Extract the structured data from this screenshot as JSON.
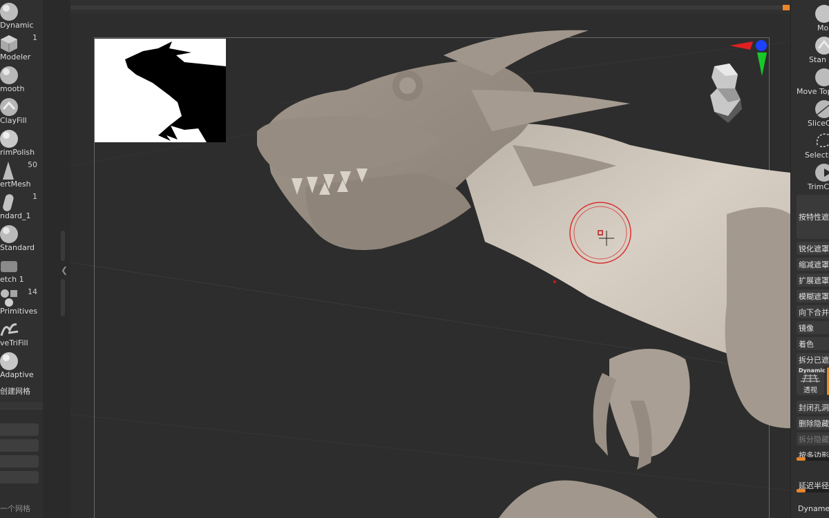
{
  "left_shelf": {
    "brushes": [
      {
        "label": "Dynamic",
        "icon": "dynamic-sphere-icon",
        "count": ""
      },
      {
        "label": "Modeler",
        "icon": "modeler-cube-icon",
        "count": "1"
      },
      {
        "label": "mooth",
        "icon": "smooth-sphere-icon",
        "count": ""
      },
      {
        "label": "ClayFill",
        "icon": "clayfill-icon",
        "count": ""
      },
      {
        "label": "rimPolish",
        "icon": "trimpolish-icon",
        "count": ""
      },
      {
        "label": "ertMesh",
        "icon": "insertmesh-cone-icon",
        "count": "50"
      },
      {
        "label": "ndard_1",
        "icon": "standard-capsule-icon",
        "count": "1"
      },
      {
        "label": "Standard",
        "icon": "standard-sphere-icon",
        "count": ""
      },
      {
        "label": "etch 1",
        "icon": "sketch-icon",
        "count": ""
      },
      {
        "label": "Primitives",
        "icon": "primitives-icon",
        "count": "14"
      },
      {
        "label": "veTriFill",
        "icon": "curvetrifill-icon",
        "count": ""
      },
      {
        "label": "Adaptive",
        "icon": "adaptive-sphere-icon",
        "count": ""
      }
    ],
    "create_mesh_label": "创建网格",
    "footer_label": "一个网格"
  },
  "right_panel": {
    "tools": [
      {
        "label": "Mo",
        "icon": "move-brush-icon"
      },
      {
        "label": "Stan",
        "icon": "standard-brush-icon"
      },
      {
        "label": "Move Top",
        "icon": "move-topological-icon"
      },
      {
        "label": "SliceC",
        "icon": "slice-curve-icon"
      },
      {
        "label": "Selecti",
        "icon": "selection-lasso-icon"
      },
      {
        "label": "TrimC",
        "icon": "trim-curve-icon"
      }
    ],
    "mask_by_feature": "按特性遮",
    "buttons": [
      {
        "label": "锐化遮罩",
        "dim": false
      },
      {
        "label": "缩减遮罩",
        "dim": false
      },
      {
        "label": "扩展遮罩",
        "dim": false
      },
      {
        "label": "模糊遮罩",
        "dim": false
      },
      {
        "label": "向下合并",
        "dim": false
      },
      {
        "label": "镜像",
        "dim": false
      },
      {
        "label": "着色",
        "dim": false
      },
      {
        "label": "拆分已遮",
        "dim": false
      }
    ],
    "dynamic_button": {
      "top": "Dynamic",
      "bottom": "透视"
    },
    "buttons2": [
      {
        "label": "封闭孔洞",
        "dim": false
      },
      {
        "label": "删除隐藏",
        "dim": false
      },
      {
        "label": "拆分隐藏",
        "dim": true
      },
      {
        "label": "按多边形",
        "dim": false
      }
    ],
    "radius_label": "延迟半径",
    "slider1_fraction": 0.25,
    "slider2_fraction": 0.25,
    "footer": "Dyname"
  },
  "canvas": {
    "background_color": "#2d2d2d",
    "model_color": "#9a8f84"
  },
  "colors": {
    "accent": "#e8862a",
    "gyro_red": "#e02020",
    "gyro_green": "#18c828",
    "gyro_blue": "#1e40ff",
    "brush_ring": "#d83030"
  }
}
